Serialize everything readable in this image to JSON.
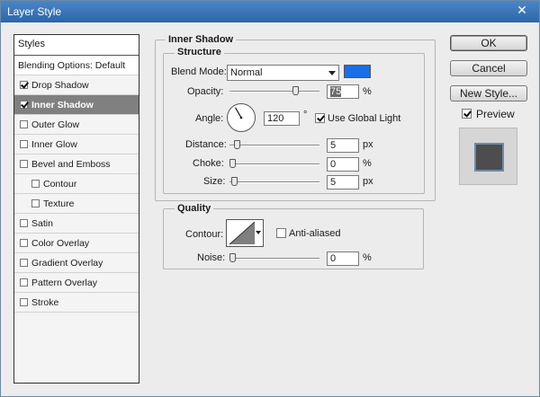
{
  "window": {
    "title": "Layer Style",
    "close_glyph": "✕"
  },
  "styles_panel": {
    "header": "Styles",
    "items": [
      {
        "label": "Blending Options: Default",
        "checkbox": false,
        "checked": false,
        "active": false,
        "sub": false
      },
      {
        "label": "Drop Shadow",
        "checkbox": true,
        "checked": true,
        "active": false,
        "sub": false
      },
      {
        "label": "Inner Shadow",
        "checkbox": true,
        "checked": true,
        "active": true,
        "sub": false
      },
      {
        "label": "Outer Glow",
        "checkbox": true,
        "checked": false,
        "active": false,
        "sub": false
      },
      {
        "label": "Inner Glow",
        "checkbox": true,
        "checked": false,
        "active": false,
        "sub": false
      },
      {
        "label": "Bevel and Emboss",
        "checkbox": true,
        "checked": false,
        "active": false,
        "sub": false
      },
      {
        "label": "Contour",
        "checkbox": true,
        "checked": false,
        "active": false,
        "sub": true
      },
      {
        "label": "Texture",
        "checkbox": true,
        "checked": false,
        "active": false,
        "sub": true
      },
      {
        "label": "Satin",
        "checkbox": true,
        "checked": false,
        "active": false,
        "sub": false
      },
      {
        "label": "Color Overlay",
        "checkbox": true,
        "checked": false,
        "active": false,
        "sub": false
      },
      {
        "label": "Gradient Overlay",
        "checkbox": true,
        "checked": false,
        "active": false,
        "sub": false
      },
      {
        "label": "Pattern Overlay",
        "checkbox": true,
        "checked": false,
        "active": false,
        "sub": false
      },
      {
        "label": "Stroke",
        "checkbox": true,
        "checked": false,
        "active": false,
        "sub": false
      }
    ]
  },
  "inner_shadow": {
    "title": "Inner Shadow",
    "structure": {
      "title": "Structure",
      "blend_mode_label": "Blend Mode:",
      "blend_mode_value": "Normal",
      "shadow_color": "#1a6fe6",
      "opacity_label": "Opacity:",
      "opacity_value": "75",
      "opacity_unit": "%",
      "opacity_level": 0.75,
      "angle_label": "Angle:",
      "angle_value": "120",
      "angle_unit": "°",
      "angle_degrees": 120,
      "use_global_light_label": "Use Global Light",
      "use_global_light_checked": true,
      "distance_label": "Distance:",
      "distance_value": "5",
      "distance_unit": "px",
      "distance_level": 0.05,
      "choke_label": "Choke:",
      "choke_value": "0",
      "choke_unit": "%",
      "choke_level": 0,
      "size_label": "Size:",
      "size_value": "5",
      "size_unit": "px",
      "size_level": 0.02
    },
    "quality": {
      "title": "Quality",
      "contour_label": "Contour:",
      "anti_aliased_label": "Anti-aliased",
      "anti_aliased_checked": false,
      "noise_label": "Noise:",
      "noise_value": "0",
      "noise_unit": "%",
      "noise_level": 0
    }
  },
  "buttons": {
    "ok": "OK",
    "cancel": "Cancel",
    "new_style": "New Style...",
    "preview_label": "Preview",
    "preview_checked": true
  }
}
